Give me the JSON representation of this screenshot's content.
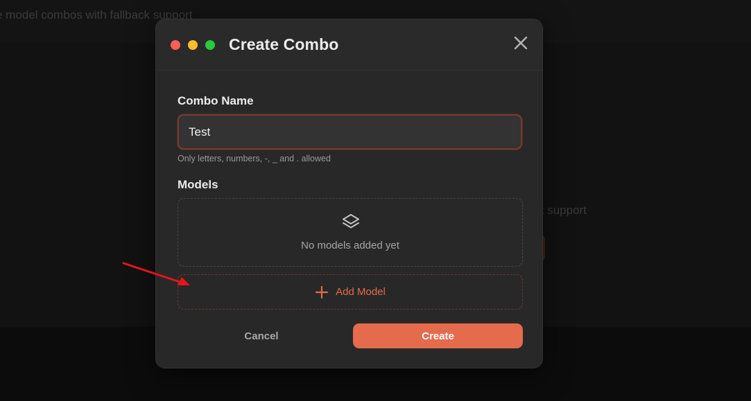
{
  "background": {
    "topbar_text": "e model combos with fallback support",
    "card_text": "k support"
  },
  "modal": {
    "title": "Create Combo",
    "close_icon": "close-icon",
    "window_controls": [
      "red",
      "yellow",
      "green"
    ]
  },
  "form": {
    "combo_name_label": "Combo Name",
    "combo_name_value": "Test",
    "combo_name_hint": "Only letters, numbers, -, _ and . allowed",
    "models_label": "Models",
    "models_empty_icon": "layers-icon",
    "models_empty_text": "No models added yet",
    "add_model_label": "Add Model",
    "add_model_icon": "plus-icon"
  },
  "actions": {
    "cancel_label": "Cancel",
    "create_label": "Create"
  },
  "colors": {
    "accent": "#e56b4d",
    "modal_bg": "#282828",
    "annotation_arrow": "#e8141b"
  }
}
